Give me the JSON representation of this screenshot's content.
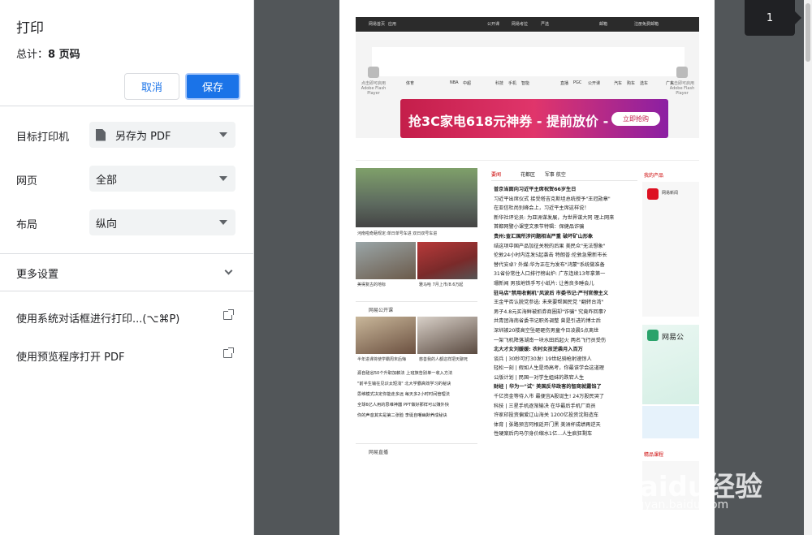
{
  "dialog": {
    "title": "打印",
    "total_label": "总计：",
    "total_value": "8 页码",
    "cancel_label": "取消",
    "save_label": "保存",
    "destination_label": "目标打印机",
    "destination_value": "另存为 PDF",
    "pages_label": "网页",
    "pages_value": "全部",
    "layout_label": "布局",
    "layout_value": "纵向",
    "more_settings_label": "更多设置",
    "system_dialog_label": "使用系统对话框进行打印...(⌥⌘P)",
    "open_preview_label": "使用预览程序打开 PDF"
  },
  "preview": {
    "page_number": "1",
    "top_bar_items": [
      "网易首页",
      "应用",
      "公开课",
      "网易考拉",
      "严选",
      "邮箱",
      "注册免费邮箱"
    ],
    "nav_items": [
      "体育",
      "NBA",
      "中超",
      "科技",
      "手机",
      "智能",
      "直播",
      "PGC",
      "公开课",
      "汽车",
      "购车",
      "选车",
      "广东"
    ],
    "banner_text": "抢3C家电618元神券 - 提前放价 -",
    "banner_button": "立即抢购",
    "flash_text": "点击即可启用 Adobe Flash Player",
    "tabs": [
      "要闻",
      "花都区",
      "军事",
      "航空"
    ],
    "my_products": "我的产品",
    "photo_captions": [
      "河南啦奇葩规定:单日单号车进 双日双号车进",
      "美得复古的地标",
      "雅马哈 7月上市/8.6万起"
    ],
    "open_course": "网易公开课",
    "course_captions": [
      "半年进课将使学霸周末后悔",
      "慈善我的人都这样把天聊死"
    ],
    "course_list": [
      "源自硅谷50个升职加薪法  上班族告别单一收入方法",
      "\"前半生输在见识太短浅\"  北大学霸高效学习的秘诀",
      "思维模式决定你能走多远  每天多2小时时间管理法",
      "全球6亿人用的思维神器  PPT做好那样可以赚外快",
      "你的声音其实是第二张脸  李诞自嘲幽默养成秘诀"
    ],
    "live_label": "网易直播",
    "headlines": [
      {
        "text": "普京当面向习近平主席祝贺66岁生日",
        "bold": true
      },
      {
        "text": "习近平出席仪式 接受塔吉克斯坦总统授予\"王冠勋章\"",
        "bold": false
      },
      {
        "text": "在亚信杜尚别峰会上，习近平主席这样说！",
        "bold": false
      },
      {
        "text": "新华社评论员: 为亚洲谋发展，为世界谋大同 理上网来",
        "bold": false
      },
      {
        "text": "首都网警小课堂文汞节特辑：保健品诈骗",
        "bold": false
      },
      {
        "text": "贵州:查汇国所涉问题相当严重 破坏矿山形象",
        "bold": true
      },
      {
        "text": "结这项中国产品加征关税的后果 美民众\"无法想象\"",
        "bold": false
      },
      {
        "text": "伦敦24小时内连发5起袭击 特朗普:伦敦急需新市长",
        "bold": false
      },
      {
        "text": "替代安卓? 外媒:华为正在为发布\"鸿蒙\"系统做准备",
        "bold": false
      },
      {
        "text": "31省份常住人口排行榜出炉: 广东连续13年拿第一",
        "bold": false
      },
      {
        "text": "珊新闻 男孩地铁手写小纸片: 让善良多睡会儿",
        "bold": false
      },
      {
        "text": "驻马店\"禁用收割机\"风波后 市委书记:严刊官僚主义",
        "bold": true
      },
      {
        "text": "王金平否认脱党参选: 未来要帮国民党 \"翻转台湾\"",
        "bold": false
      },
      {
        "text": "男子4.8元买海鲜被抓券商圈却\"诈骗\" 究竟咋回事?",
        "bold": false
      },
      {
        "text": "共青团海南省委书记职务调整 曾是引进的博士后",
        "bold": false
      },
      {
        "text": "深圳被20楼高空坠砸砸伤男童今日凌晨5点离世",
        "bold": false
      },
      {
        "text": "一架飞机降落湖南一块水田后起火 两名飞行员受伤",
        "bold": false
      },
      {
        "text": "北大才女刘媛媛: 农村女孩逆袭月入百万",
        "bold": true
      },
      {
        "text": "谈兵 | 30秒可打30发! 19世纪骑枪射速惊人",
        "bold": false
      },
      {
        "text": "轻松一刻 | 假如人生是场高考，你最该学会这道理",
        "bold": false
      },
      {
        "text": "公版计划 | 民国一对学生姐妹的跌宕人生",
        "bold": false
      },
      {
        "text": "财经 | 华为一\"试\" 美国反华政客的智商就露馅了",
        "bold": true
      },
      {
        "text": "千亿资金等待入市 最便宜A股诞生! 24万股民哭了",
        "bold": false
      },
      {
        "text": "科技 | 三星手机逐渐输决 在华最后手机厂商员",
        "bold": false
      },
      {
        "text": "许家印投资偏爱辽山海关 1200亿投资沈阳造车",
        "bold": false
      },
      {
        "text": "体育 | 张路预言阿根廷开门黑 美洲杯成绩再逆天",
        "bold": false
      },
      {
        "text": "性硬案后内马尔身价缩水1亿...人生疯狂剩车",
        "bold": false
      }
    ],
    "side_labels": [
      "网易新闻",
      "网易公",
      "精品课程"
    ],
    "watermark": "Baidu经验",
    "watermark_sub": "jingyan.baidu.com"
  },
  "colors": {
    "accent": "#1a73e8",
    "preview_bg": "#525659",
    "news_red": "#c00"
  }
}
